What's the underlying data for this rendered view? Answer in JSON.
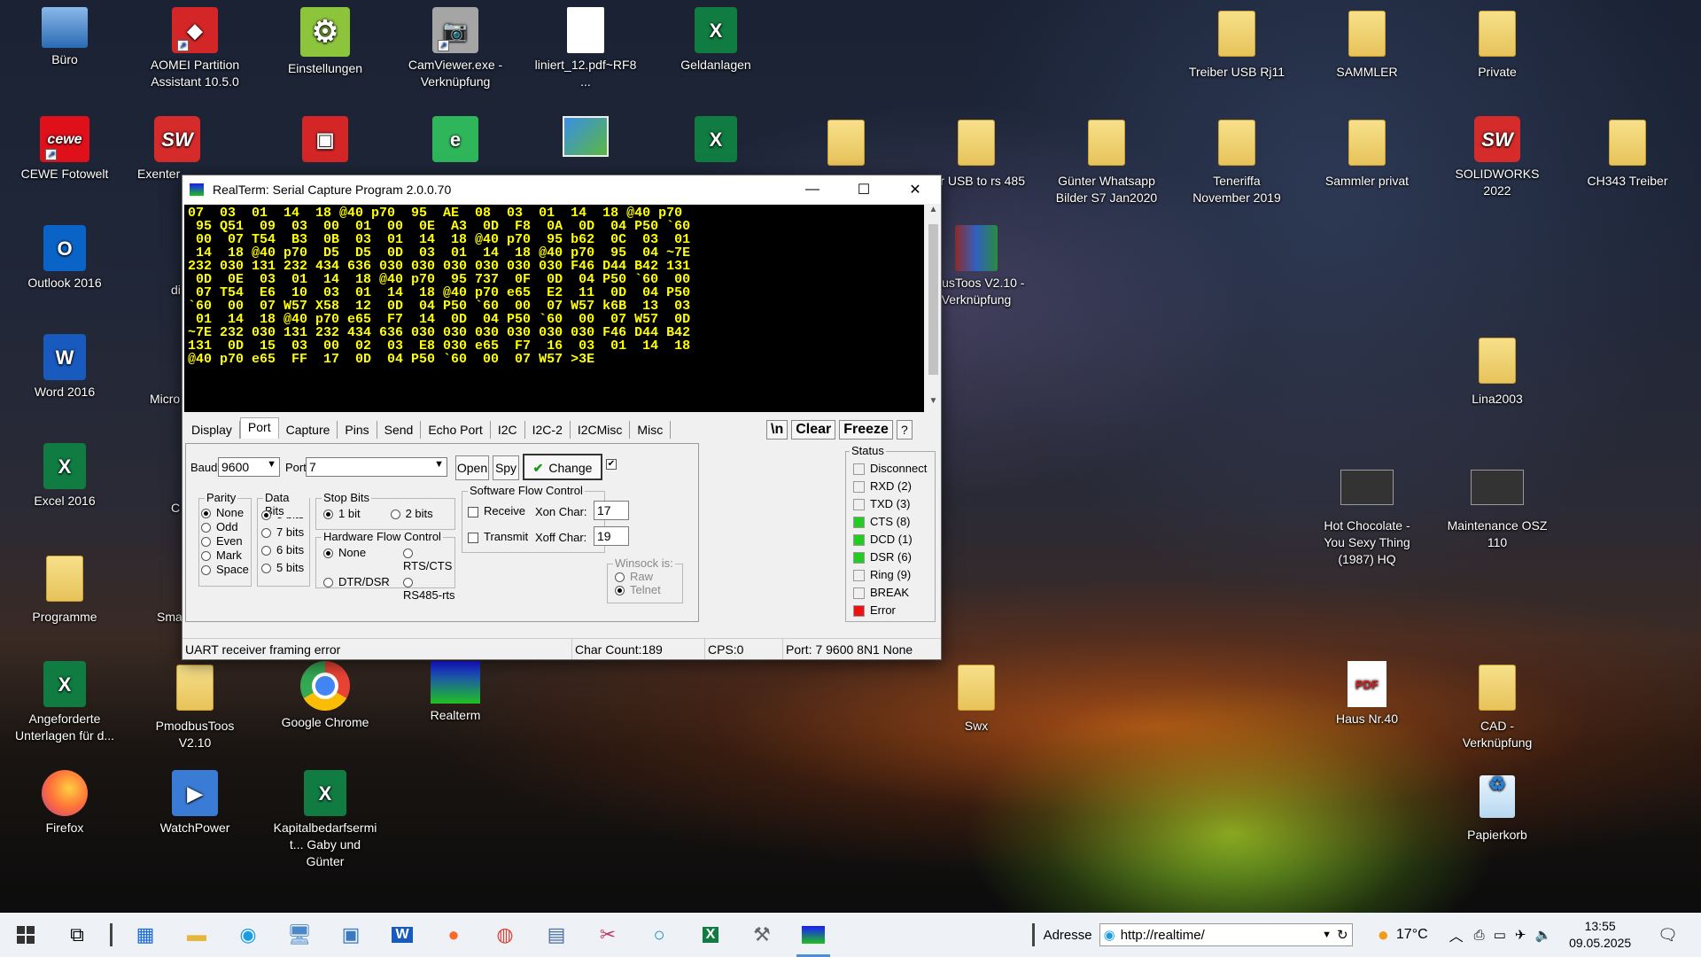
{
  "window": {
    "title": "RealTerm: Serial Capture Program 2.0.0.70",
    "terminal_lines": [
      "07  03  01  14  18 @40 p70  95  AE  08  03  01  14  18 @40 p70",
      " 95 Q51  09  03  00  01  00  0E  A3  0D  F8  0A  0D  04 P50 `60",
      " 00  07 T54  B3  0B  03  01  14  18 @40 p70  95 b62  0C  03  01",
      " 14  18 @40 p70  D5  D5  0D  03  01  14  18 @40 p70  95  04 ~7E",
      "232 030 131 232 434 636 030 030 030 030 030 030 F46 D44 B42 131",
      " 0D  0E  03  01  14  18 @40 p70  95 737  0F  0D  04 P50 `60  00",
      " 07 T54  E6  10  03  01  14  18 @40 p70 e65  E2  11  0D  04 P50",
      "`60  00  07 W57 X58  12  0D  04 P50 `60  00  07 W57 k6B  13  03",
      " 01  14  18 @40 p70 e65  F7  14  0D  04 P50 `60  00  07 W57  0D",
      "~7E 232 030 131 232 434 636 030 030 030 030 030 030 F46 D44 B42",
      "131  0D  15  03  00  02  03  E8 030 e65  F7  16  03  01  14  18",
      "@40 p70 e65  FF  17  0D  04 P50 `60  00  07 W57 >3E"
    ],
    "tabs": [
      "Display",
      "Port",
      "Capture",
      "Pins",
      "Send",
      "Echo Port",
      "I2C",
      "I2C-2",
      "I2CMisc",
      "Misc"
    ],
    "active_tab": "Port",
    "tab_buttons": {
      "newline": "\\n",
      "clear": "Clear",
      "freeze": "Freeze",
      "help": "?"
    },
    "port": {
      "baud_label": "Baud",
      "baud_value": "9600",
      "port_label": "Port",
      "port_value": "7",
      "open": "Open",
      "spy": "Spy",
      "change": "Change",
      "parity_title": "Parity",
      "parity": [
        "None",
        "Odd",
        "Even",
        "Mark",
        "Space"
      ],
      "parity_selected": "None",
      "databits_title": "Data Bits",
      "databits": [
        "8 bits",
        "7 bits",
        "6 bits",
        "5 bits"
      ],
      "databits_selected": "8 bits",
      "stopbits_title": "Stop Bits",
      "stopbits": [
        "1 bit",
        "2 bits"
      ],
      "stopbits_selected": "1 bit",
      "hwflow_title": "Hardware Flow Control",
      "hwflow": [
        "None",
        "RTS/CTS",
        "DTR/DSR",
        "RS485-rts"
      ],
      "hwflow_selected": "None",
      "swflow_title": "Software Flow Control",
      "receive": "Receive",
      "transmit": "Transmit",
      "xon_label": "Xon Char:",
      "xon_value": "17",
      "xoff_label": "Xoff Char:",
      "xoff_value": "19",
      "winsock_title": "Winsock is:",
      "winsock": [
        "Raw",
        "Telnet"
      ],
      "winsock_selected": "Telnet"
    },
    "status_panel": {
      "title": "Status",
      "items": [
        {
          "label": "Disconnect",
          "color": "#f0f0f0"
        },
        {
          "label": "RXD (2)",
          "color": "#f0f0f0"
        },
        {
          "label": "TXD (3)",
          "color": "#f0f0f0"
        },
        {
          "label": "CTS (8)",
          "color": "#22cc22"
        },
        {
          "label": "DCD (1)",
          "color": "#22cc22"
        },
        {
          "label": "DSR (6)",
          "color": "#22cc22"
        },
        {
          "label": "Ring (9)",
          "color": "#f0f0f0"
        },
        {
          "label": "BREAK",
          "color": "#f0f0f0"
        },
        {
          "label": "Error",
          "color": "#ee1111"
        }
      ]
    },
    "statusbar": {
      "message": "UART receiver framing error",
      "char_count": "Char Count:189",
      "cps": "CPS:0",
      "port": "Port: 7 9600 8N1 None"
    }
  },
  "desktop_icons": [
    {
      "label": "Büro",
      "icon": "computer-icon"
    },
    {
      "label": "AOMEI Partition Assistant 10.5.0",
      "icon": "aomei-icon"
    },
    {
      "label": "Einstellungen",
      "icon": "gear-icon"
    },
    {
      "label": "CamViewer.exe - Verknüpfung",
      "icon": "camera-icon"
    },
    {
      "label": "liniert_12.pdf~RF8...",
      "icon": "document-icon"
    },
    {
      "label": "Geldanlagen",
      "icon": "excel-icon"
    },
    {
      "label": "Treiber USB Rj11",
      "icon": "folder-icon"
    },
    {
      "label": "SAMMLER",
      "icon": "folder-icon"
    },
    {
      "label": "Private",
      "icon": "folder-icon"
    },
    {
      "label": "CEWE Fotowelt",
      "icon": "cewe-icon"
    },
    {
      "label": "Exenter",
      "icon": "solidworks-icon"
    },
    {
      "label": "er USB to rs 485",
      "icon": "folder-icon"
    },
    {
      "label": "Günter Whatsapp Bilder S7 Jan2020",
      "icon": "folder-icon"
    },
    {
      "label": "Teneriffa November 2019",
      "icon": "folder-icon"
    },
    {
      "label": "Sammler privat",
      "icon": "folder-icon"
    },
    {
      "label": "SOLIDWORKS 2022",
      "icon": "solidworks-icon"
    },
    {
      "label": "CH343 Treiber",
      "icon": "folder-icon"
    },
    {
      "label": "Outlook 2016",
      "icon": "outlook-icon"
    },
    {
      "label": "di",
      "icon": "folder-icon"
    },
    {
      "label": "dbusToos V2.10 - Verknüpfung",
      "icon": "winrar-icon"
    },
    {
      "label": "Word 2016",
      "icon": "word-icon"
    },
    {
      "label": "Micro",
      "icon": "edge-icon"
    },
    {
      "label": "Lina2003",
      "icon": "folder-icon"
    },
    {
      "label": "Excel 2016",
      "icon": "excel-icon"
    },
    {
      "label": "C",
      "icon": "app-icon"
    },
    {
      "label": "Hot Chocolate - You Sexy Thing (1987) HQ",
      "icon": "video-thumbnail-icon"
    },
    {
      "label": "Maintenance OSZ 110",
      "icon": "video-thumbnail-icon"
    },
    {
      "label": "Programme",
      "icon": "folder-icon"
    },
    {
      "label": "Sma",
      "icon": "app-icon"
    },
    {
      "label": "Angeforderte Unterlagen für d...",
      "icon": "excel-icon"
    },
    {
      "label": "PmodbusToos V2.10",
      "icon": "folder-icon"
    },
    {
      "label": "Google Chrome",
      "icon": "chrome-icon"
    },
    {
      "label": "Realterm",
      "icon": "realterm-icon"
    },
    {
      "label": "Swx",
      "icon": "folder-icon"
    },
    {
      "label": "Haus Nr.40",
      "icon": "pdf-icon"
    },
    {
      "label": "CAD - Verknüpfung",
      "icon": "folder-icon"
    },
    {
      "label": "Firefox",
      "icon": "firefox-icon"
    },
    {
      "label": "WatchPower",
      "icon": "watchpower-icon"
    },
    {
      "label": "Kapitalbedarfsermit... Gaby und Günter",
      "icon": "excel-icon"
    },
    {
      "label": "Papierkorb",
      "icon": "recycle-bin-icon"
    }
  ],
  "taskbar": {
    "address_label": "Adresse",
    "address_value": "http://realtime/",
    "temperature": "17°C",
    "time": "13:55",
    "date": "09.05.2025"
  }
}
